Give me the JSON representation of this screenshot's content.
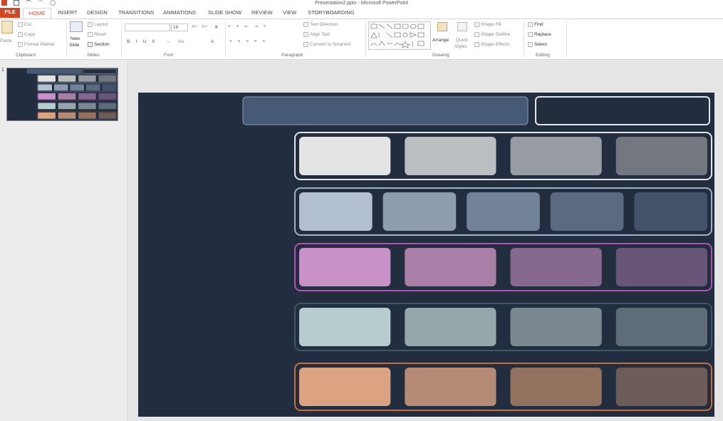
{
  "window": {
    "title": "Presentation2.pptx - Microsoft PowerPoint"
  },
  "tabs": {
    "file": "FILE",
    "items": [
      {
        "label": "HOME"
      },
      {
        "label": "INSERT"
      },
      {
        "label": "DESIGN"
      },
      {
        "label": "TRANSITIONS"
      },
      {
        "label": "ANIMATIONS"
      },
      {
        "label": "SLIDE SHOW"
      },
      {
        "label": "REVIEW"
      },
      {
        "label": "VIEW"
      },
      {
        "label": "STORYBOARDING"
      }
    ]
  },
  "ribbon": {
    "clipboard": {
      "paste": "Paste",
      "cut": "Cut",
      "copy": "Copy",
      "format_painter": "Format Painter",
      "label": "Clipboard"
    },
    "slides": {
      "new_slide_1": "New",
      "new_slide_2": "Slide",
      "layout": "Layout",
      "reset": "Reset",
      "section": "Section",
      "label": "Slides"
    },
    "font": {
      "font_name": "",
      "font_size": "18",
      "label": "Font"
    },
    "paragraph": {
      "text_direction": "Text Direction",
      "align_text": "Align Text",
      "convert_smartart": "Convert to SmartArt",
      "label": "Paragraph"
    },
    "drawing": {
      "arrange": "Arrange",
      "quick_styles_1": "Quick",
      "quick_styles_2": "Styles",
      "shape_fill": "Shape Fill",
      "shape_outline": "Shape Outline",
      "shape_effects": "Shape Effects",
      "label": "Drawing"
    },
    "editing": {
      "find": "Find",
      "replace": "Replace",
      "select": "Select",
      "label": "Editing"
    }
  },
  "thumbnails": [
    {
      "number": "1"
    }
  ],
  "slide": {
    "background": "#222e40",
    "header": {
      "left_fill": "#475a75",
      "left_border": "#7c8ea6",
      "right_fill": "#222e40",
      "right_border": "#dfe6ee"
    },
    "palette_rows": [
      {
        "name": "neutral",
        "border": "#e4e6ea",
        "swatches": [
          "#e4e4e4",
          "#bcbfc2",
          "#979ba2",
          "#727780"
        ]
      },
      {
        "name": "slate",
        "border": "#9fb1c7",
        "swatches": [
          "#b3c0d1",
          "#8e9cae",
          "#728299",
          "#5b6a7e",
          "#44526a"
        ]
      },
      {
        "name": "mauve",
        "border": "#b052b0",
        "swatches": [
          "#c892c8",
          "#a97ea7",
          "#86678d",
          "#675677"
        ]
      },
      {
        "name": "teal",
        "border": "#3e5963",
        "swatches": [
          "#b6cccf",
          "#96a6aa",
          "#7b8890",
          "#5e6d79"
        ]
      },
      {
        "name": "copper",
        "border": "#c76d37",
        "swatches": [
          "#dba381",
          "#b58b76",
          "#93715f",
          "#6e5c58"
        ]
      }
    ]
  }
}
